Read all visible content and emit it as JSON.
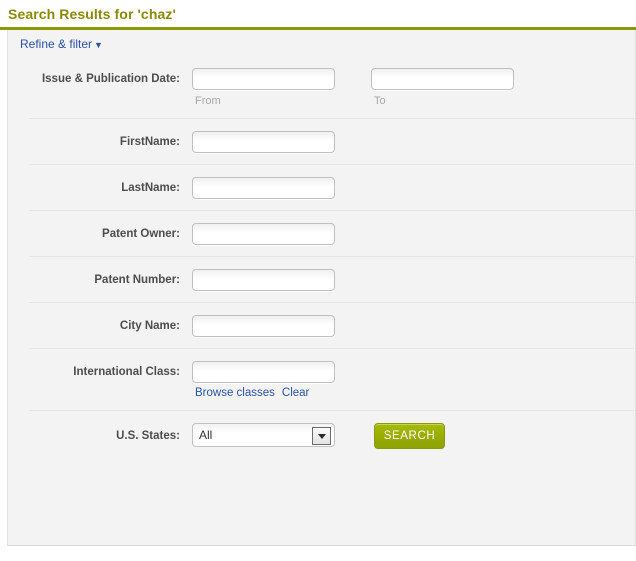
{
  "header": {
    "title": "Search Results for 'chaz'",
    "rule_color": "#8a9a06",
    "title_color": "#8a8a06"
  },
  "refine": {
    "label": "Refine & filter",
    "caret": "▼",
    "link_color": "#2b50a8"
  },
  "form": {
    "rows": [
      {
        "label": "Issue & Publication Date:",
        "from_value": "",
        "from_placeholder": "",
        "from_hint": "From",
        "to_value": "",
        "to_placeholder": "",
        "to_hint": "To"
      },
      {
        "label": "FirstName:",
        "value": "",
        "placeholder": ""
      },
      {
        "label": "LastName:",
        "value": "",
        "placeholder": ""
      },
      {
        "label": "Patent Owner:",
        "value": "",
        "placeholder": ""
      },
      {
        "label": "Patent Number:",
        "value": "",
        "placeholder": ""
      },
      {
        "label": "City Name:",
        "value": "",
        "placeholder": ""
      },
      {
        "label": "International Class:",
        "value": "",
        "placeholder": "",
        "browse_link": "Browse classes",
        "clear_link": "Clear"
      },
      {
        "label": "U.S. States:",
        "selected": "All",
        "options": [
          "All"
        ],
        "arrow": "▼"
      }
    ],
    "search_button": "SEARCH",
    "search_button_color": "#99ad04"
  }
}
